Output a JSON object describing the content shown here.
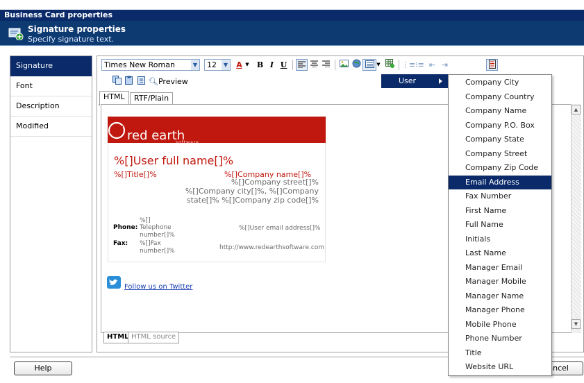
{
  "window": {
    "title": "Business Card properties"
  },
  "header": {
    "title": "Signature properties",
    "subtitle": "Specify signature text."
  },
  "sidebar": {
    "items": [
      {
        "label": "Signature",
        "active": true
      },
      {
        "label": "Font",
        "active": false
      },
      {
        "label": "Description",
        "active": false
      },
      {
        "label": "Modified",
        "active": false
      }
    ]
  },
  "toolbar": {
    "font_name": "Times New Roman",
    "font_size": "12",
    "bold": "B",
    "italic": "I",
    "underline": "U",
    "preview_label": "Preview"
  },
  "tabs": {
    "html": "HTML",
    "rtf": "RTF/Plain"
  },
  "card": {
    "brand": "red earth",
    "brand_sub": "software",
    "full_name": "%[]User full name[]%",
    "title": "%[]Title[]%",
    "company_name": "%[]Company name[]%",
    "company_street": "%[]Company street[]%",
    "company_city_line": "%[]Company city[]%, %[]Company",
    "company_state_line": "state[]% %[]Company zip code[]%",
    "phone_prefix": "%[]",
    "phone_label": "Phone:",
    "phone_value_1": "Telephone",
    "phone_value_2": "number[]%",
    "fax_label": "Fax:",
    "fax_value_1": "%[]Fax",
    "fax_value_2": "number[]%",
    "email": "%[]User email address[]%",
    "website": "http://www.redearthsoftware.com",
    "twitter_link": "Follow us on Twitter"
  },
  "editor_tabs": {
    "html": "HTML",
    "source": "HTML source"
  },
  "buttons": {
    "help": "Help",
    "cancel": "ancel"
  },
  "submenu": {
    "label": "User"
  },
  "menu": {
    "items": [
      "Company City",
      "Company Country",
      "Company Name",
      "Company P.O. Box",
      "Company State",
      "Company Street",
      "Company Zip Code",
      "Email Address",
      "Fax Number",
      "First Name",
      "Full Name",
      "Initials",
      "Last Name",
      "Manager Email",
      "Manager Mobile",
      "Manager Name",
      "Manager Phone",
      "Mobile Phone",
      "Phone Number",
      "Title",
      "Website URL"
    ],
    "highlighted": "Email Address"
  },
  "colors": {
    "brand_red": "#c0180e",
    "nav_blue": "#0a2a6a"
  }
}
